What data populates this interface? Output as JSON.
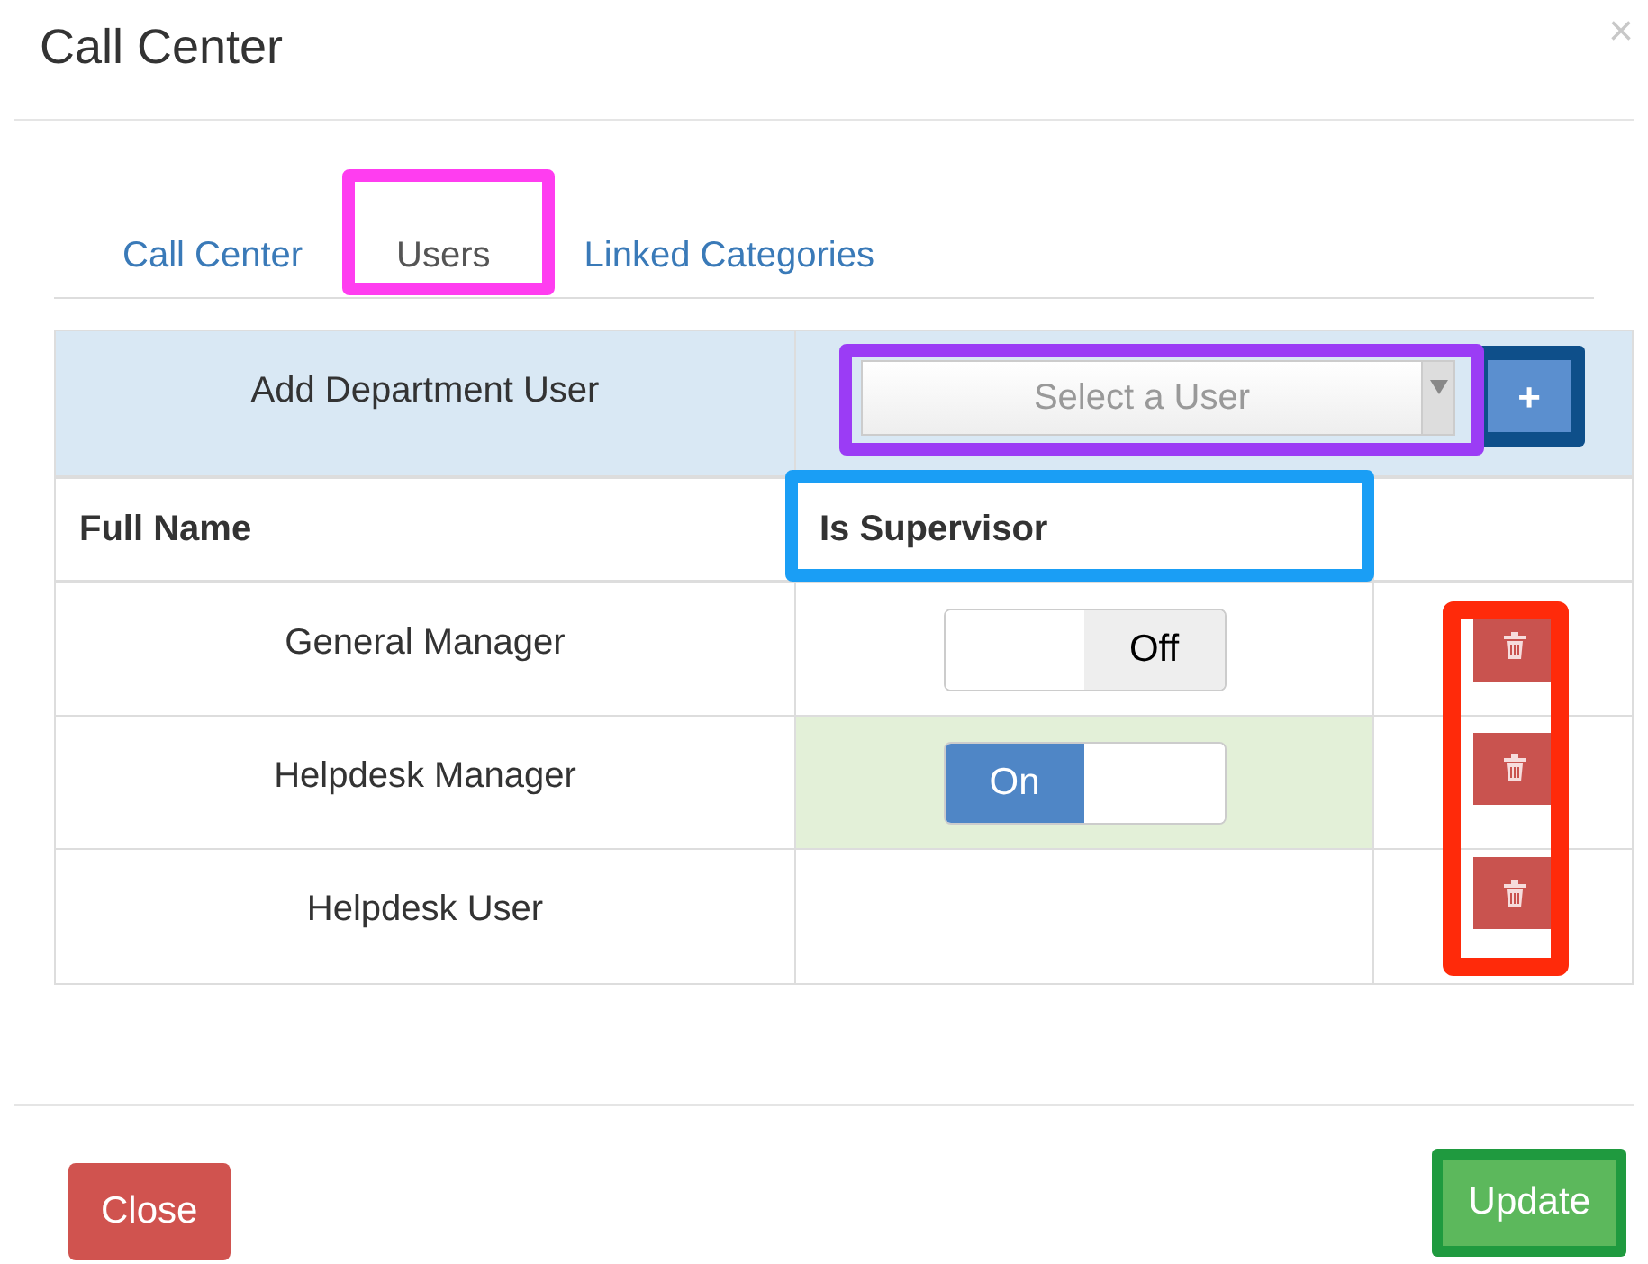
{
  "dialog": {
    "title": "Call Center",
    "close": "×"
  },
  "tabs": [
    {
      "label": "Call Center",
      "selected": false
    },
    {
      "label": "Users",
      "selected": true
    },
    {
      "label": "Linked Categories",
      "selected": false
    }
  ],
  "add_user": {
    "label": "Add Department User",
    "select": {
      "placeholder": "Select a User"
    },
    "add_button": "+"
  },
  "table": {
    "columns": [
      "Full Name",
      "Is Supervisor"
    ],
    "rows": [
      {
        "name": "General Manager",
        "kind": "toggle",
        "on": false,
        "toggle_label": "Off"
      },
      {
        "name": "Helpdesk Manager",
        "kind": "toggle",
        "on": true,
        "toggle_label": "On"
      },
      {
        "name": "Helpdesk User",
        "kind": "none"
      }
    ]
  },
  "footer": {
    "close": "Close",
    "update": "Update"
  }
}
